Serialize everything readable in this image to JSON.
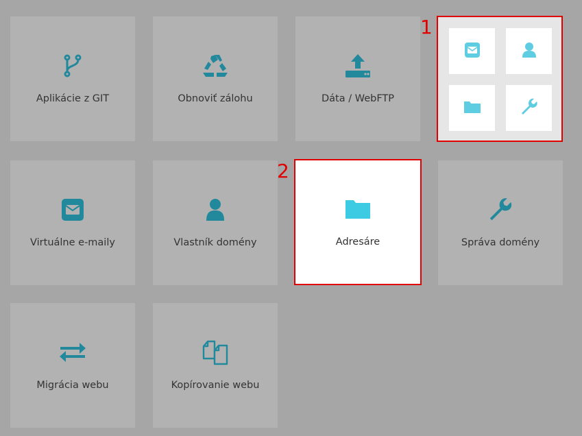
{
  "colors": {
    "icon_dark": "#21899b",
    "icon_active": "#3ccbe3",
    "icon_widget": "#5fcde1",
    "highlight": "#e00000",
    "tile_bg": "#b2b2b2",
    "page_bg": "#a6a6a6"
  },
  "tiles": [
    {
      "label": "Aplikácie z GIT",
      "icon": "git-branch-icon"
    },
    {
      "label": "Obnoviť zálohu",
      "icon": "recycle-icon"
    },
    {
      "label": "Dáta / WebFTP",
      "icon": "upload-icon"
    },
    {
      "label": "Virtuálne e-maily",
      "icon": "envelope-icon"
    },
    {
      "label": "Vlastník domény",
      "icon": "user-icon"
    },
    {
      "label": "Adresáre",
      "icon": "folder-icon"
    },
    {
      "label": "Správa domény",
      "icon": "wrench-icon"
    },
    {
      "label": "Migrácia webu",
      "icon": "exchange-arrows-icon"
    },
    {
      "label": "Kopírovanie webu",
      "icon": "copy-files-icon"
    }
  ],
  "widget": {
    "items": [
      {
        "icon": "envelope-icon"
      },
      {
        "icon": "user-icon"
      },
      {
        "icon": "folder-icon"
      },
      {
        "icon": "wrench-icon"
      }
    ]
  },
  "callouts": {
    "first": "1",
    "second": "2"
  }
}
